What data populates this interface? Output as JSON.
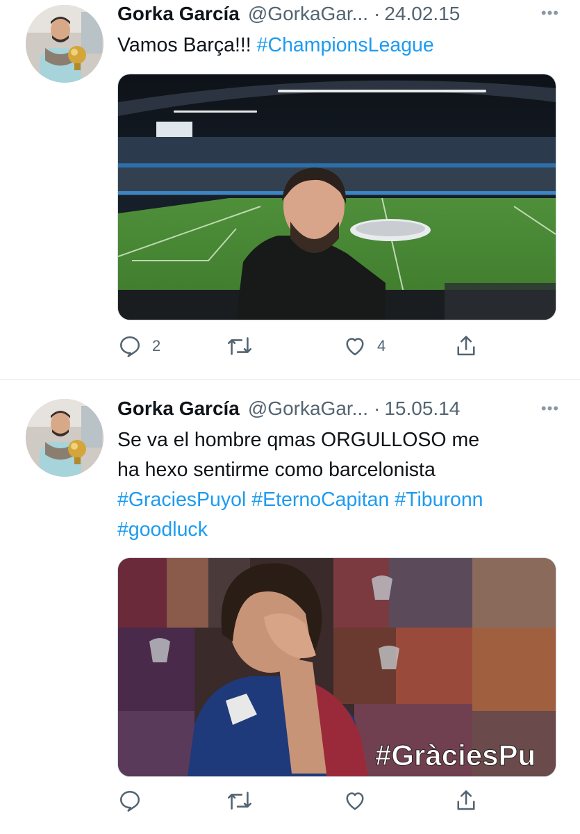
{
  "tweets": [
    {
      "author_name": "Gorka García",
      "handle": "@GorkaGar...",
      "separator": "·",
      "date": "24.02.15",
      "more_label": "•••",
      "text_parts": [
        "Vamos Barça!!! ",
        "#ChampionsLeague"
      ],
      "media_desc": "stadium-selfie",
      "replies": "2",
      "retweets": "",
      "likes": "4"
    },
    {
      "author_name": "Gorka García",
      "handle": "@GorkaGar...",
      "separator": "·",
      "date": "15.05.14",
      "more_label": "•••",
      "text_line1": "Se va el hombre qmas ORGULLOSO me",
      "text_line2": "ha hexo sentirme como barcelonista",
      "hashtags": [
        "#GraciesPuyol",
        "#EternoCapitan",
        "#Tiburonn",
        "#goodluck"
      ],
      "media_desc": "puyol-collage",
      "media_overlay_text": "#GràciesPu",
      "replies": "",
      "retweets": "",
      "likes": ""
    }
  ],
  "colors": {
    "link": "#1d9bf0",
    "secondary": "#536471",
    "text": "#0f1419"
  },
  "icons": [
    "reply-icon",
    "retweet-icon",
    "like-icon",
    "share-icon",
    "more-icon"
  ]
}
